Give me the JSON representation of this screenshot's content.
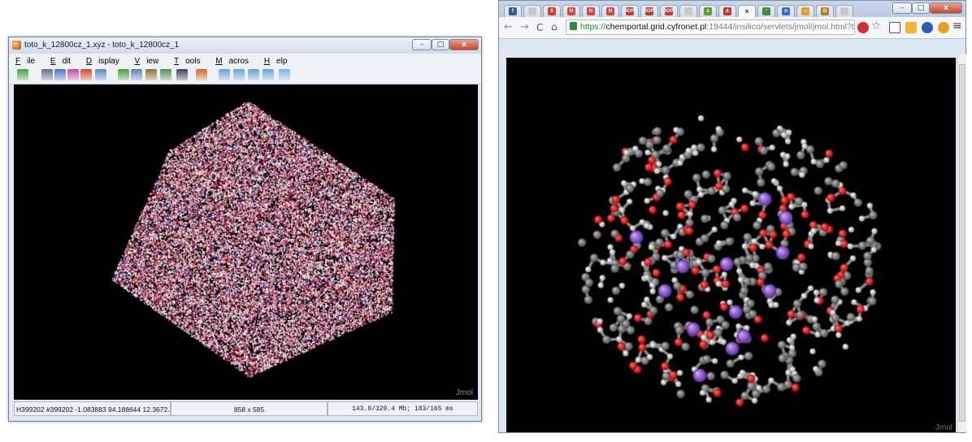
{
  "left_window": {
    "title": "toto_k_12800cz_1.xyz - toto_k_12800cz_1",
    "controls": [
      "–",
      "□",
      "x"
    ],
    "menu": [
      {
        "mnemonic": "F",
        "rest": "ile"
      },
      {
        "mnemonic": "E",
        "rest": "dit"
      },
      {
        "mnemonic": "D",
        "rest": "isplay"
      },
      {
        "mnemonic": "V",
        "rest": "iew"
      },
      {
        "mnemonic": "T",
        "rest": "ools"
      },
      {
        "mnemonic": "M",
        "rest": "acros"
      },
      {
        "mnemonic": "H",
        "rest": "elp"
      }
    ],
    "toolbar_icons": [
      "open-icon",
      "screenshot-icon",
      "colors-icon",
      "spin-icon",
      "measure-icon",
      "print-icon",
      "rotate-icon",
      "select-icon",
      "pencil-icon",
      "zoom-icon",
      "cross-icon",
      "home-icon",
      "first-frame-icon",
      "prev-frame-icon",
      "next-frame-icon",
      "last-frame-icon",
      "extra-icon"
    ],
    "viewer_label": "Jmol",
    "status": {
      "atom_info": "H399202 #399202 -1.083883 94.188644 12.3672...",
      "size": "858 x 585",
      "memory": "143.9/329.4 Mb; 183/165 ms"
    }
  },
  "browser": {
    "window_controls": [
      "–",
      "□",
      "x"
    ],
    "tabs": [
      {
        "icon": "facebook-icon",
        "color": "#3b5998",
        "glyph": "f"
      },
      {
        "icon": "blank-page-icon",
        "color": "#c8c8c8",
        "glyph": ""
      },
      {
        "icon": "s-icon",
        "color": "#d33b2c",
        "glyph": "S"
      },
      {
        "icon": "n-icon",
        "color": "#d8453b",
        "glyph": "N"
      },
      {
        "icon": "n-icon",
        "color": "#d8453b",
        "glyph": "N"
      },
      {
        "icon": "n-icon",
        "color": "#d8453b",
        "glyph": "N"
      },
      {
        "icon": "iop-icon",
        "color": "#c03b2b",
        "glyph": "IOP"
      },
      {
        "icon": "iop-icon",
        "color": "#c03b2b",
        "glyph": "IOP"
      },
      {
        "icon": "iop-icon",
        "color": "#c03b2b",
        "glyph": "IOP"
      },
      {
        "icon": "blank-page-icon",
        "color": "#c8c8c8",
        "glyph": ""
      },
      {
        "icon": "green-icon",
        "color": "#5aa02c",
        "glyph": "s"
      },
      {
        "icon": "flask-icon",
        "color": "#c0392b",
        "glyph": "∆"
      },
      {
        "icon": "active-tab-close-icon",
        "color": "#ffffff",
        "glyph": "×"
      },
      {
        "icon": "molecule-icon",
        "color": "#3b8f3b",
        "glyph": "¹"
      },
      {
        "icon": "blue-icon",
        "color": "#3a6fc4",
        "glyph": "n"
      },
      {
        "icon": "hexagon-icon",
        "color": "#e0a030",
        "glyph": "○"
      },
      {
        "icon": "omega-icon",
        "color": "#b08030",
        "glyph": "Ω"
      },
      {
        "icon": "blank-page-icon",
        "color": "#c8c8c8",
        "glyph": ""
      }
    ],
    "url": {
      "scheme": "https://",
      "host": "chemportal.grid.cyfronet.pl",
      "path": ":19444/insilico/servlets/jmol/jmol.html?t"
    },
    "viewer_label": "Jmol"
  }
}
